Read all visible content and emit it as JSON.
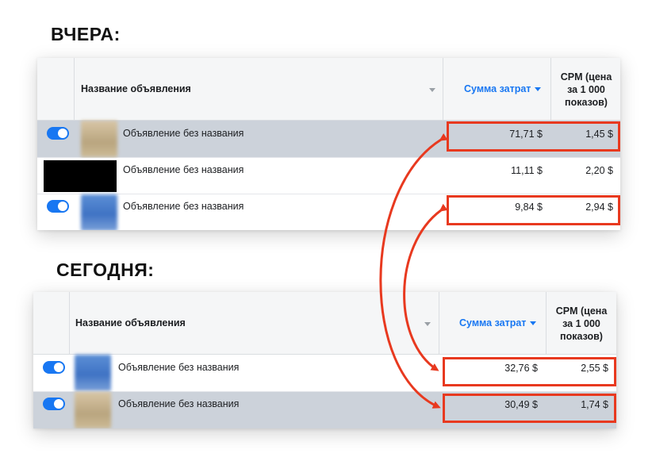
{
  "headings": {
    "yesterday": "ВЧЕРА:",
    "today": "СЕГОДНЯ:"
  },
  "columns": {
    "ad_name": "Название объявления",
    "spend": "Сумма затрат",
    "cpm_line1": "CPM (цена",
    "cpm_line2": "за 1 000",
    "cpm_line3": "показов)"
  },
  "yesterday": {
    "rows": [
      {
        "name": "Объявление без названия",
        "spend": "71,71 $",
        "cpm": "1,45 $",
        "toggle_on": true,
        "thumbnail": "beige"
      },
      {
        "name": "Объявление без названия",
        "spend": "11,11 $",
        "cpm": "2,20 $",
        "toggle_on": false,
        "thumbnail": "redacted"
      },
      {
        "name": "Объявление без названия",
        "spend": "9,84 $",
        "cpm": "2,94 $",
        "toggle_on": true,
        "thumbnail": "blue"
      }
    ]
  },
  "today": {
    "rows": [
      {
        "name": "Объявление без названия",
        "spend": "32,76 $",
        "cpm": "2,55 $",
        "toggle_on": true,
        "thumbnail": "blue"
      },
      {
        "name": "Объявление без названия",
        "spend": "30,49 $",
        "cpm": "1,74 $",
        "toggle_on": true,
        "thumbnail": "beige"
      }
    ]
  },
  "colors": {
    "accent": "#1877f2",
    "highlight_box": "#e8391f",
    "shaded_row": "#ccd2da"
  }
}
